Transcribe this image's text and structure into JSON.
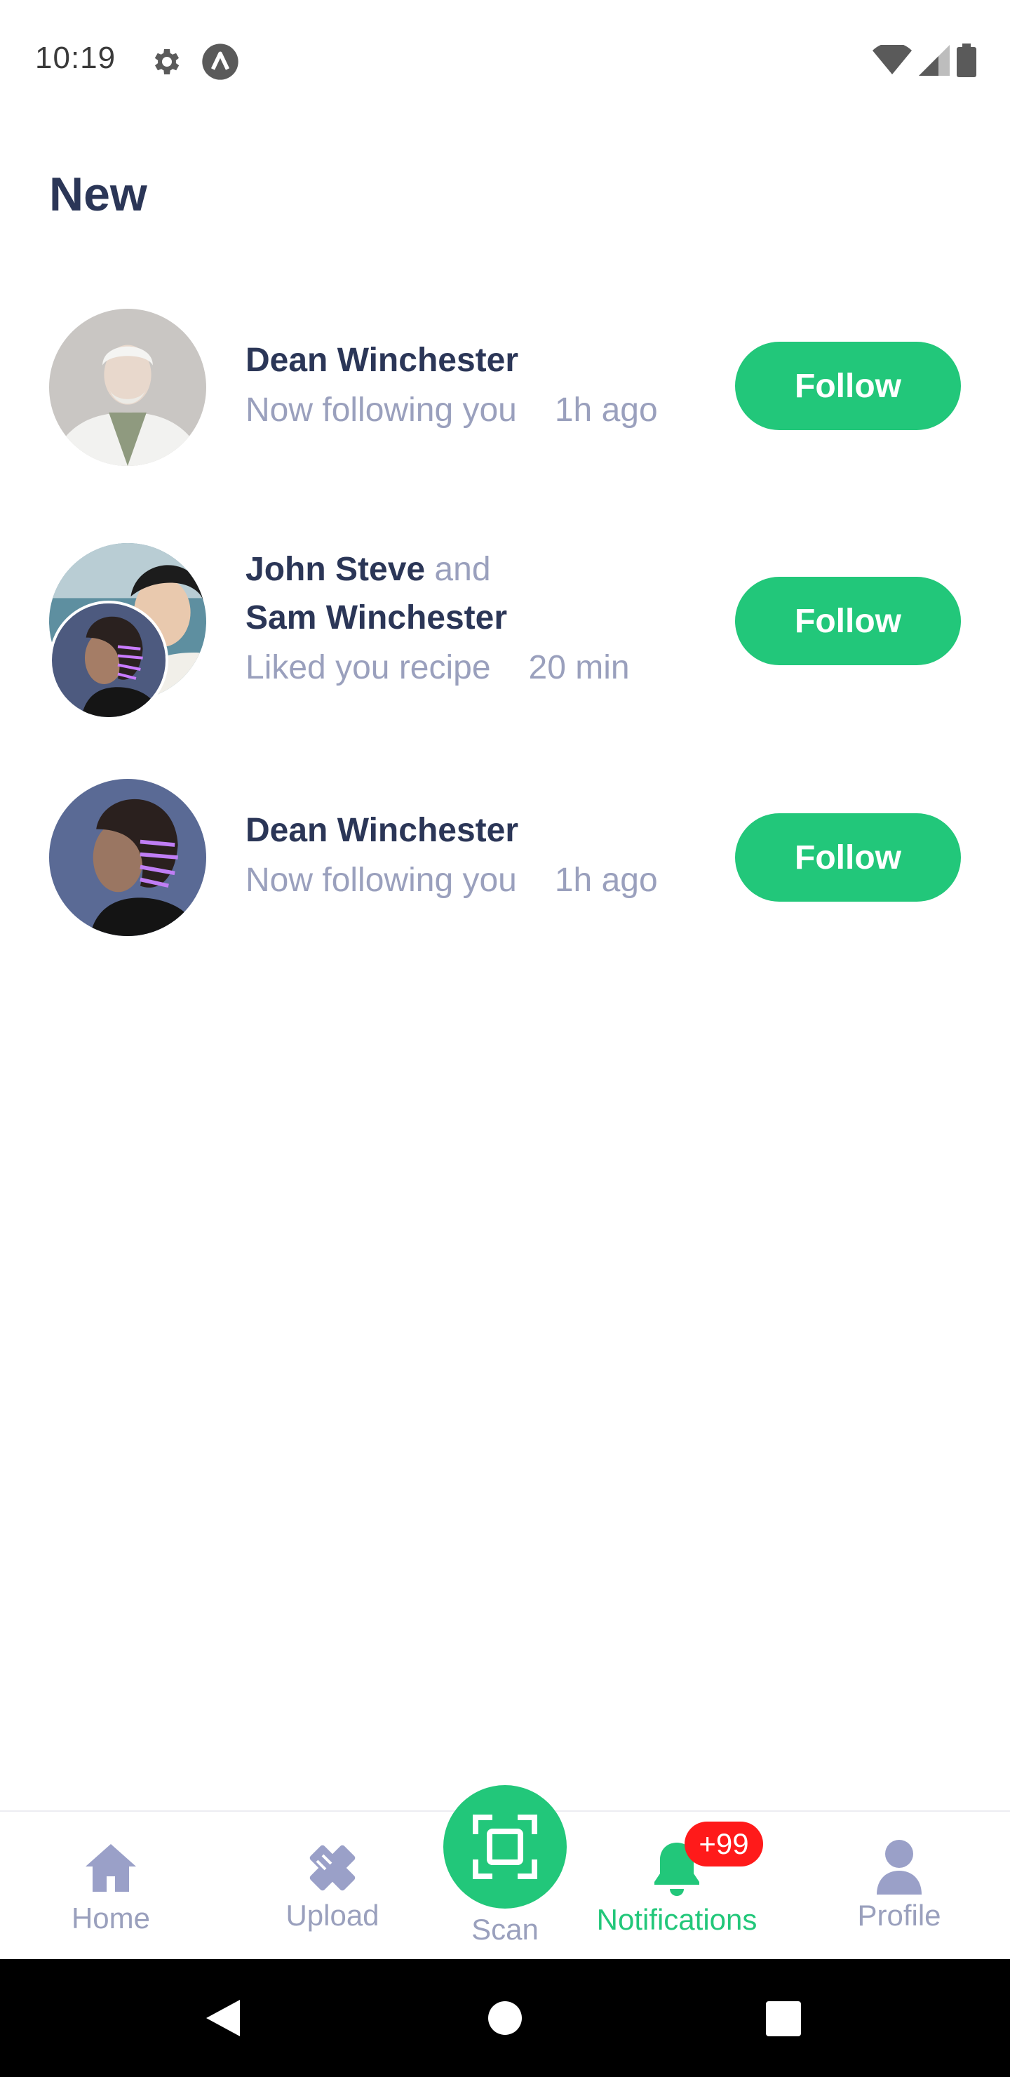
{
  "status_bar": {
    "time": "10:19",
    "icons": [
      "gear-icon",
      "app-icon",
      "wifi-icon",
      "signal-icon",
      "battery-icon"
    ]
  },
  "section_title": "New",
  "notifications": [
    {
      "names": [
        "Dean Winchester"
      ],
      "conjunction": "",
      "action": "Now following you",
      "time": "1h ago",
      "button": "Follow"
    },
    {
      "names": [
        "John Steve",
        "Sam Winchester"
      ],
      "conjunction": "and",
      "action": "Liked you recipe",
      "time": "20 min",
      "button": "Follow"
    },
    {
      "names": [
        "Dean Winchester"
      ],
      "conjunction": "",
      "action": "Now following you",
      "time": "1h ago",
      "button": "Follow"
    }
  ],
  "bottom_nav": {
    "items": [
      {
        "label": "Home",
        "icon": "home-icon"
      },
      {
        "label": "Upload",
        "icon": "upload-icon"
      },
      {
        "label": "Scan",
        "icon": "scan-icon"
      },
      {
        "label": "Notifications",
        "icon": "bell-icon"
      },
      {
        "label": "Profile",
        "icon": "profile-icon"
      }
    ],
    "active": "Notifications",
    "badge": "+99"
  },
  "colors": {
    "accent": "#22c77a",
    "title": "#2b3657",
    "muted": "#9aa0bd",
    "badge": "#ff1a1a"
  }
}
